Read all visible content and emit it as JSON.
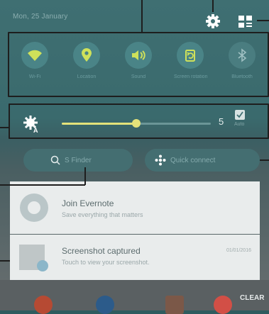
{
  "header": {
    "date": "Mon, 25 January",
    "settings_icon": "gear-icon",
    "grid_icon": "quick-setting-buttons-icon"
  },
  "toggles": [
    {
      "label": "Wi-Fi",
      "icon": "wifi-icon",
      "state": "on"
    },
    {
      "label": "Location",
      "icon": "location-icon",
      "state": "on"
    },
    {
      "label": "Sound",
      "icon": "sound-icon",
      "state": "on"
    },
    {
      "label": "Screen rotation",
      "icon": "rotation-icon",
      "state": "on"
    },
    {
      "label": "Bluetooth",
      "icon": "bluetooth-icon",
      "state": "off"
    }
  ],
  "brightness": {
    "value": "5",
    "level_fraction": 0.5,
    "auto_label": "Auto",
    "auto_checked": true
  },
  "buttons": {
    "sfinder": "S Finder",
    "quick_connect": "Quick connect"
  },
  "notifications": [
    {
      "title": "Join Evernote",
      "subtitle": "Save everything that matters",
      "time": ""
    },
    {
      "title": "Screenshot captured",
      "subtitle": "Touch to view your screenshot.",
      "time": "01/01/2016"
    }
  ],
  "bottom": {
    "clear": "CLEAR"
  }
}
